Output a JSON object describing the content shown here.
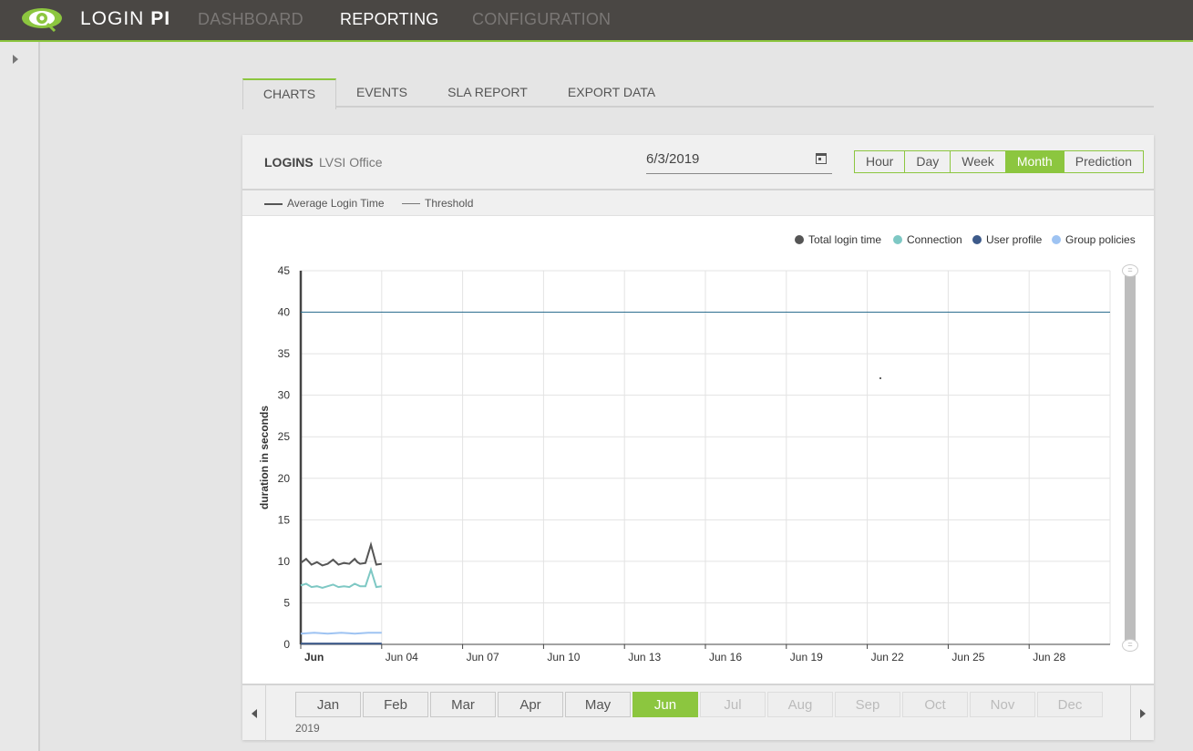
{
  "app": {
    "brand_light": "LOGIN ",
    "brand_bold": "PI"
  },
  "nav": [
    {
      "label": "DASHBOARD",
      "active": false
    },
    {
      "label": "REPORTING",
      "active": true
    },
    {
      "label": "CONFIGURATION",
      "active": false
    }
  ],
  "tabs": [
    {
      "label": "CHARTS",
      "active": true
    },
    {
      "label": "EVENTS",
      "active": false
    },
    {
      "label": "SLA REPORT",
      "active": false
    },
    {
      "label": "EXPORT DATA",
      "active": false
    }
  ],
  "card": {
    "title": "LOGINS",
    "subtitle": "LVSI Office",
    "date_value": "6/3/2019",
    "ranges": [
      {
        "label": "Hour",
        "active": false
      },
      {
        "label": "Day",
        "active": false
      },
      {
        "label": "Week",
        "active": false
      },
      {
        "label": "Month",
        "active": true
      },
      {
        "label": "Prediction",
        "active": false
      }
    ],
    "line_legend": [
      {
        "label": "Average Login Time"
      },
      {
        "label": "Threshold"
      }
    ]
  },
  "chart_data": {
    "type": "line",
    "ylabel": "duration in seconds",
    "ylim": [
      0,
      45
    ],
    "yticks": [
      0,
      5,
      10,
      15,
      20,
      25,
      30,
      35,
      40,
      45
    ],
    "xtick_labels": [
      "Jun",
      "Jun 04",
      "Jun 07",
      "Jun 10",
      "Jun 13",
      "Jun 16",
      "Jun 19",
      "Jun 22",
      "Jun 25",
      "Jun 28"
    ],
    "x_range_days": [
      1,
      31
    ],
    "threshold": 40,
    "grid": true,
    "legend_position": "top-right",
    "series": [
      {
        "name": "Total login time",
        "color": "#555555",
        "x": [
          1.0,
          1.2,
          1.4,
          1.6,
          1.8,
          2.0,
          2.2,
          2.4,
          2.6,
          2.8,
          2.9,
          3.0,
          3.1,
          3.2,
          3.4,
          3.6,
          3.8,
          4.0
        ],
        "y": [
          9.8,
          10.3,
          9.6,
          9.9,
          9.5,
          9.7,
          10.2,
          9.6,
          9.8,
          9.7,
          10.0,
          10.3,
          9.9,
          9.7,
          9.8,
          12.0,
          9.6,
          9.7
        ]
      },
      {
        "name": "Connection",
        "color": "#7ec8c4",
        "x": [
          1.0,
          1.2,
          1.4,
          1.6,
          1.8,
          2.0,
          2.2,
          2.4,
          2.6,
          2.8,
          3.0,
          3.2,
          3.4,
          3.6,
          3.8,
          4.0
        ],
        "y": [
          7.1,
          7.3,
          6.9,
          7.0,
          6.8,
          7.0,
          7.2,
          6.9,
          7.0,
          6.9,
          7.3,
          7.0,
          7.0,
          9.0,
          6.9,
          7.0
        ]
      },
      {
        "name": "User profile",
        "color": "#3d5a8a",
        "x": [
          1.0,
          2.0,
          3.0,
          4.0
        ],
        "y": [
          0.1,
          0.1,
          0.1,
          0.1
        ]
      },
      {
        "name": "Group policies",
        "color": "#9ec3f2",
        "x": [
          1.0,
          1.5,
          2.0,
          2.5,
          3.0,
          3.5,
          4.0
        ],
        "y": [
          1.3,
          1.4,
          1.3,
          1.4,
          1.3,
          1.4,
          1.4
        ]
      }
    ]
  },
  "month_bar": {
    "year": "2019",
    "months": [
      {
        "label": "Jan",
        "state": "normal"
      },
      {
        "label": "Feb",
        "state": "normal"
      },
      {
        "label": "Mar",
        "state": "normal"
      },
      {
        "label": "Apr",
        "state": "normal"
      },
      {
        "label": "May",
        "state": "normal"
      },
      {
        "label": "Jun",
        "state": "active"
      },
      {
        "label": "Jul",
        "state": "disabled"
      },
      {
        "label": "Aug",
        "state": "disabled"
      },
      {
        "label": "Sep",
        "state": "disabled"
      },
      {
        "label": "Oct",
        "state": "disabled"
      },
      {
        "label": "Nov",
        "state": "disabled"
      },
      {
        "label": "Dec",
        "state": "disabled"
      }
    ]
  },
  "colors": {
    "accent": "#8cc63f",
    "topbar": "#4a4744",
    "threshold": "#2c6e8f"
  }
}
